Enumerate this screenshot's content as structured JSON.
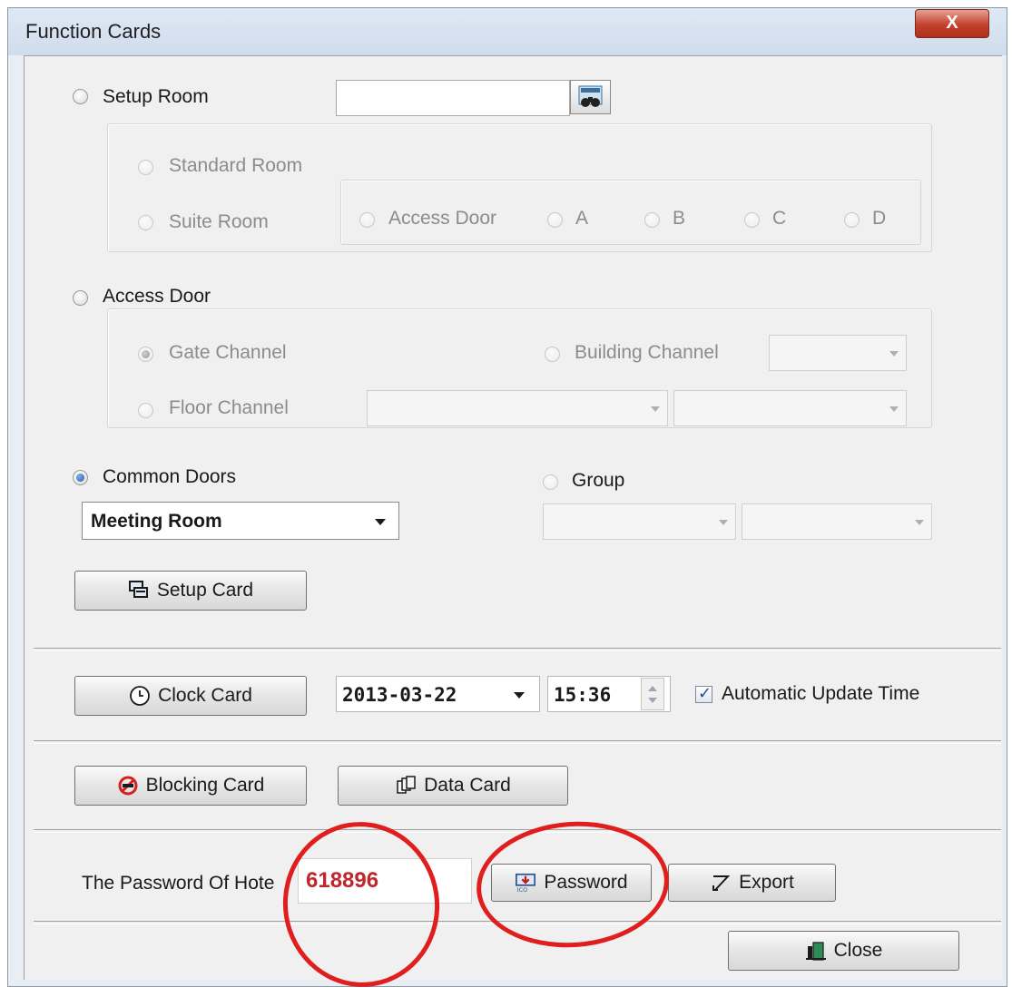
{
  "window": {
    "title": "Function Cards",
    "close_glyph": "X"
  },
  "setup_room": {
    "label": "Setup Room",
    "room_value": "",
    "standard_room": "Standard Room",
    "suite_room": "Suite Room",
    "access_door": "Access Door",
    "door_a": "A",
    "door_b": "B",
    "door_c": "C",
    "door_d": "D"
  },
  "access_door": {
    "label": "Access Door",
    "gate_channel": "Gate Channel",
    "building_channel": "Building Channel",
    "floor_channel": "Floor Channel"
  },
  "common_doors": {
    "label": "Common Doors",
    "selected": "Meeting Room"
  },
  "group": {
    "label": "Group"
  },
  "buttons": {
    "setup_card": "Setup Card",
    "clock_card": "Clock Card",
    "blocking_card": "Blocking Card",
    "data_card": "Data Card",
    "password": "Password",
    "export": "Export",
    "close": "Close"
  },
  "clock": {
    "date": "2013-03-22",
    "time": "15:36",
    "auto_update_label": "Automatic Update Time",
    "auto_update_checked": true
  },
  "hotel": {
    "password_label": "The Password Of Hote",
    "password_value": "618896"
  },
  "colors": {
    "annotation_red": "#e01e1e",
    "password_text": "#c0262b",
    "selected_radio": "#1d5ea8"
  }
}
